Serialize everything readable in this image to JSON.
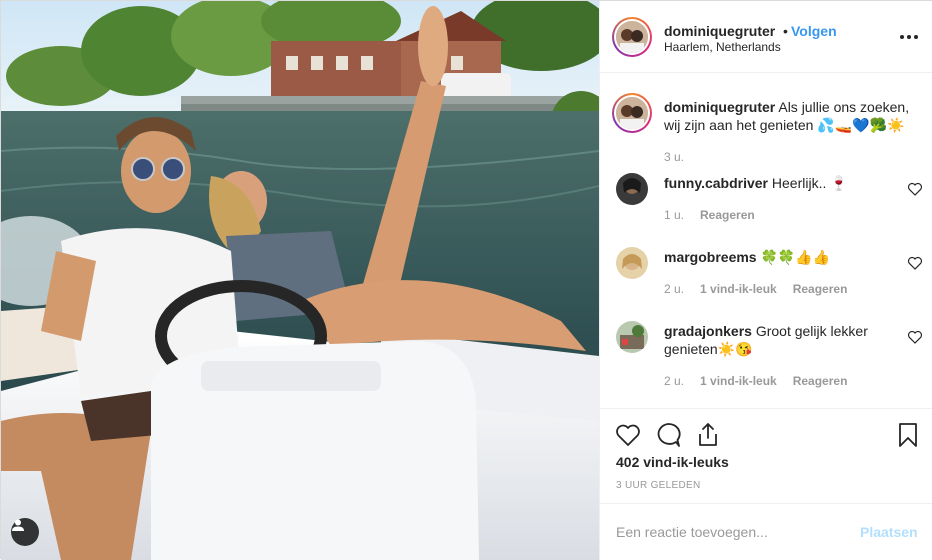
{
  "post": {
    "username": "dominiquegruter",
    "separator": "•",
    "follow_label": "Volgen",
    "location": "Haarlem, Netherlands",
    "caption_user": "dominiquegruter",
    "caption_text": " Als jullie ons zoeken, wij zijn aan het genieten 💦🚤💙🥦☀️",
    "caption_age": "3 u."
  },
  "comments": [
    {
      "user": "funny.cabdriver",
      "text": " Heerlijk.. 🍷",
      "age": "1 u.",
      "likes": "",
      "reply": "Reageren"
    },
    {
      "user": "margobreems",
      "text": " 🍀🍀👍👍",
      "age": "2 u.",
      "likes": "1 vind-ik-leuk",
      "reply": "Reageren"
    },
    {
      "user": "gradajonkers",
      "text": " Groot gelijk lekker genieten☀️😘",
      "age": "2 u.",
      "likes": "1 vind-ik-leuk",
      "reply": "Reageren"
    }
  ],
  "stats": {
    "likes": "402 vind-ik-leuks",
    "date": "3 UUR GELEDEN"
  },
  "composer": {
    "placeholder": "Een reactie toevoegen...",
    "post_label": "Plaatsen"
  },
  "icons": {
    "more": "more-options-icon",
    "heart": "heart-icon",
    "comment": "comment-icon",
    "share": "share-icon",
    "save": "bookmark-icon",
    "user_tag": "user-tag-icon"
  },
  "colors": {
    "accent": "#3897f0",
    "post_disabled": "#b2dffc",
    "muted": "#999999",
    "text": "#262626"
  }
}
